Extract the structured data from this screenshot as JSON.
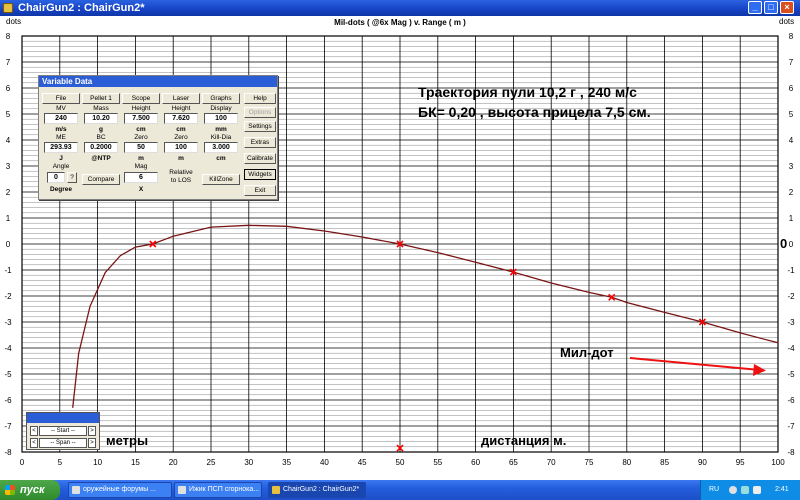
{
  "window": {
    "title": "ChairGun2 : ChairGun2*"
  },
  "chart": {
    "title": "Mil-dots ( @6x Mag ) v. Range ( m )",
    "y_unit_left": "dots",
    "y_unit_right": "dots",
    "annotation_title_line1": "Траектория пули  10,2 г ,  240 м/с",
    "annotation_title_line2": "БК= 0,20 , высота прицела 7,5 см.",
    "annotation_mildot": "Мил-дот",
    "annotation_meters": "метры",
    "annotation_distance": "дистанция м.",
    "annotation_zero": "0"
  },
  "chart_data": {
    "type": "line",
    "title": "Mil-dots ( @6x Mag ) v. Range ( m )",
    "xlabel": "",
    "ylabel": "dots",
    "xlim": [
      0,
      100
    ],
    "ylim": [
      -8,
      8
    ],
    "x_ticks": [
      "0",
      "5",
      "10",
      "15",
      "20",
      "25",
      "30",
      "35",
      "40",
      "45",
      "50",
      "55",
      "60",
      "65",
      "70",
      "75",
      "80",
      "85",
      "90",
      "95",
      "100"
    ],
    "y_ticks": [
      "8",
      "7",
      "6",
      "5",
      "4",
      "3",
      "2",
      "1",
      "0",
      "-1",
      "-2",
      "-3",
      "-4",
      "-5",
      "-6",
      "-7",
      "-8"
    ],
    "grid": true,
    "series": [
      {
        "x": [
          6.7,
          7.5,
          9,
          11,
          13,
          15,
          17.3,
          20,
          25,
          30,
          35,
          40,
          45,
          50,
          55,
          60,
          65,
          70,
          75,
          78,
          80,
          85,
          90,
          95,
          100
        ],
        "y": [
          -6.3,
          -4.2,
          -2.4,
          -1.1,
          -0.45,
          -0.12,
          0.0,
          0.3,
          0.65,
          0.72,
          0.68,
          0.5,
          0.27,
          0.0,
          -0.33,
          -0.7,
          -1.08,
          -1.5,
          -1.86,
          -2.05,
          -2.25,
          -2.63,
          -3.0,
          -3.42,
          -3.8
        ]
      }
    ],
    "markers": [
      {
        "x": 17.3,
        "y": 0.0
      },
      {
        "x": 50,
        "y": 0.0
      },
      {
        "x": 65,
        "y": -1.08
      },
      {
        "x": 78,
        "y": -2.05
      },
      {
        "x": 90,
        "y": -3.0
      },
      {
        "x": 50,
        "y": -7.85
      }
    ]
  },
  "variable_data": {
    "title": "Variable Data",
    "buttons": {
      "file": "File",
      "pellet": "Pellet 1",
      "scope": "Scope",
      "laser": "Laser",
      "graphs": "Graphs",
      "help": "Help",
      "options": "Options",
      "settings": "Settings",
      "extras": "Extras",
      "calibrate": "Calibrate",
      "widgets": "Widgets",
      "exit": "Exit",
      "compare": "Compare",
      "killzone": "KillZone",
      "angle_q": "?"
    },
    "labels": {
      "mv": "MV",
      "mass": "Mass",
      "height": "Height",
      "laser_height": "Height",
      "display": "Display",
      "mv_unit": "m/s",
      "mass_unit": "g",
      "height_unit": "cm",
      "laser_unit": "cm",
      "display_unit": "mm",
      "me": "ME",
      "bc": "BC",
      "zero": "Zero",
      "laser_zero": "Zero",
      "killdia": "Kill-Dia",
      "me_unit": "J",
      "bc_unit": "@NTP",
      "zero_unit": "m",
      "laser_zero_unit": "m",
      "killdia_unit": "cm",
      "angle": "Angle",
      "mag": "Mag",
      "relative": "Relative",
      "to_los": "to LOS",
      "degree": "Degree",
      "mag_unit": "X"
    },
    "values": {
      "mv": "240",
      "mass": "10.20",
      "height": "7.500",
      "laser_height": "7.620",
      "display": "100",
      "me": "293.93",
      "bc": "0.2000",
      "zero": "50",
      "laser_zero": "100",
      "killdia": "3.000",
      "angle": "0",
      "mag": "6"
    }
  },
  "start_span": {
    "start": "-- Start --",
    "span": "-- Span --",
    "left": "<",
    "right": ">"
  },
  "taskbar": {
    "start": "пуск",
    "tasks": [
      "оружейные форумы ...",
      "Ижик ПСП сгорнока...",
      "ChairGun2 : ChairGun2*"
    ],
    "lang": "RU",
    "clock": "2:41"
  }
}
